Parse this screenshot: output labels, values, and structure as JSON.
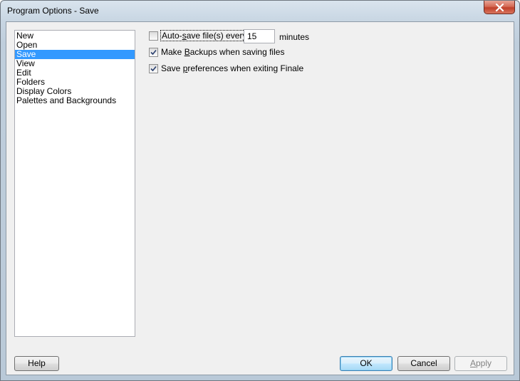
{
  "window": {
    "title": "Program Options - Save",
    "close_glyph": "close-icon"
  },
  "categories": {
    "items": [
      {
        "label": "New",
        "selected": false
      },
      {
        "label": "Open",
        "selected": false
      },
      {
        "label": "Save",
        "selected": true
      },
      {
        "label": "View",
        "selected": false
      },
      {
        "label": "Edit",
        "selected": false
      },
      {
        "label": "Folders",
        "selected": false
      },
      {
        "label": "Display Colors",
        "selected": false
      },
      {
        "label": "Palettes and Backgrounds",
        "selected": false
      }
    ]
  },
  "options": {
    "autosave": {
      "label_pre": "Auto-",
      "label_mnemonic": "s",
      "label_post": "ave file(s) every",
      "checked": false,
      "value": "15",
      "unit": "minutes"
    },
    "backups": {
      "label_pre": "Make ",
      "label_mnemonic": "B",
      "label_post": "ackups when saving files",
      "checked": true
    },
    "save_prefs": {
      "label_pre": "Save ",
      "label_mnemonic": "p",
      "label_post": "references when exiting Finale",
      "checked": true
    }
  },
  "buttons": {
    "help": "Help",
    "ok": "OK",
    "cancel": "Cancel",
    "apply_pre": "",
    "apply_mnemonic": "A",
    "apply_post": "pply"
  },
  "colors": {
    "selection": "#3399ff",
    "default_button_border": "#3c7fb1"
  }
}
